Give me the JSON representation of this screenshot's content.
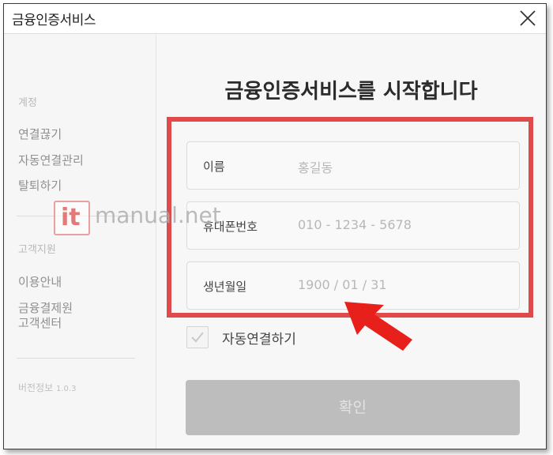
{
  "window": {
    "title": "금융인증서비스"
  },
  "sidebar": {
    "account_header": "계정",
    "account_items": [
      {
        "label": "연결끊기"
      },
      {
        "label": "자동연결관리"
      },
      {
        "label": "탈퇴하기"
      }
    ],
    "support_header": "고객지원",
    "support_items": [
      {
        "label": "이용안내"
      },
      {
        "label": "금융결제원\n고객센터"
      }
    ],
    "version_label": "버전정보",
    "version_number": "1.0.3"
  },
  "main": {
    "heading": "금융인증서비스를 시작합니다",
    "fields": {
      "name": {
        "label": "이름",
        "placeholder": "홍길동"
      },
      "phone": {
        "label": "휴대폰번호",
        "placeholder": "010 - 1234 - 5678"
      },
      "birth": {
        "label": "생년월일",
        "placeholder": "1900 / 01 / 31"
      }
    },
    "auto_connect_label": "자동연결하기",
    "confirm_label": "확인"
  },
  "watermark": {
    "badge": "it",
    "text": "manual.net"
  },
  "colors": {
    "highlight": "#e04a4a",
    "arrow": "#e8201c",
    "button_disabled": "#bdbdbd"
  }
}
